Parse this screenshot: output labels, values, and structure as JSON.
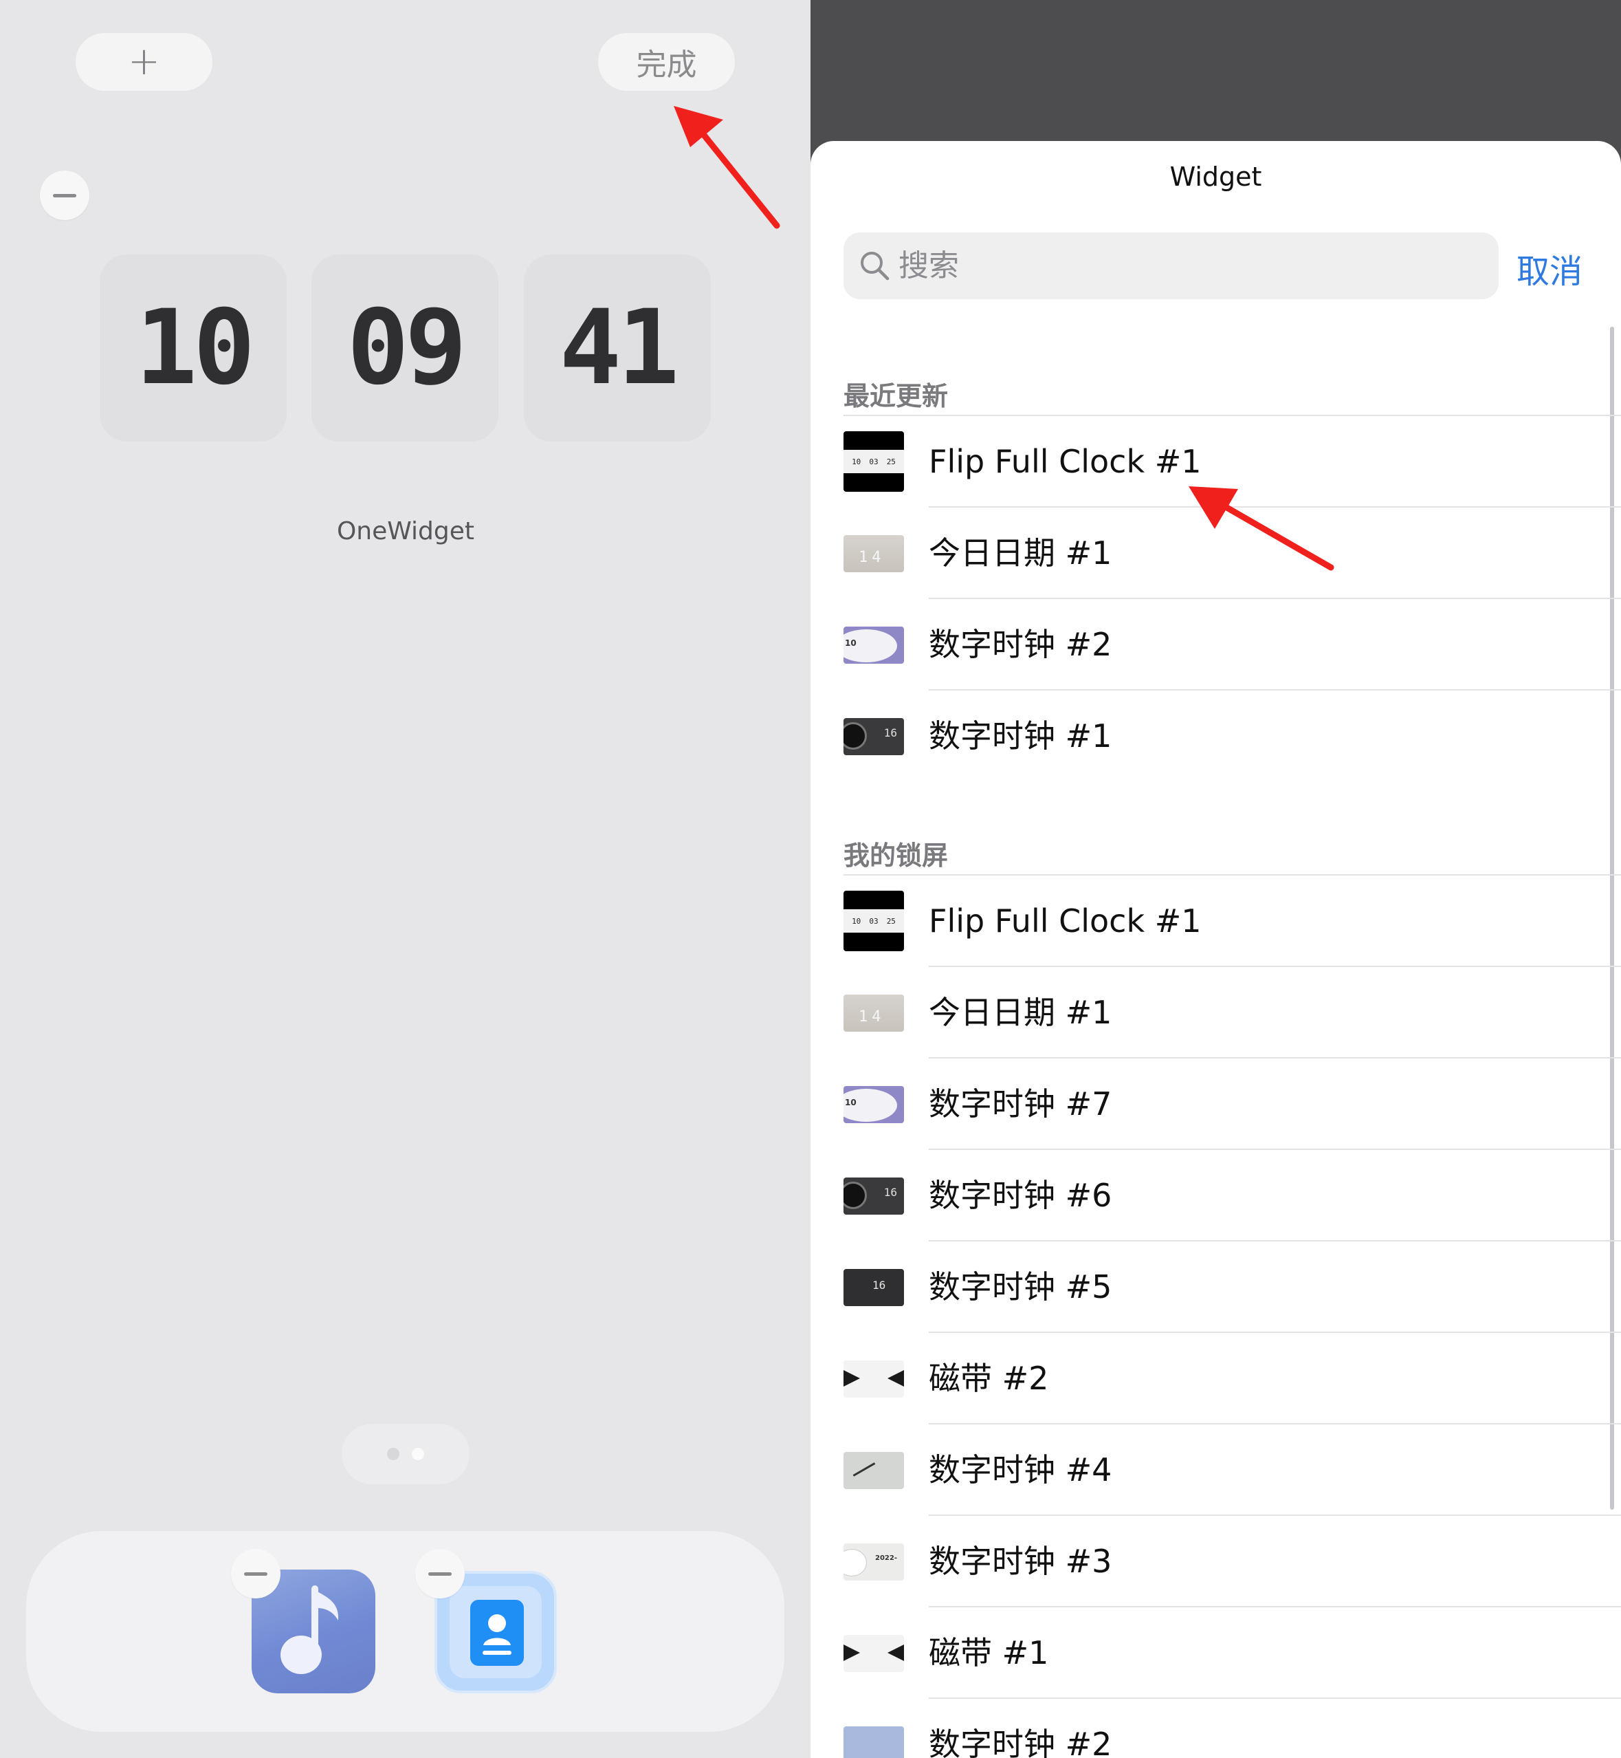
{
  "home": {
    "add_label": "+",
    "done_label": "完成",
    "clock": {
      "hours": "10",
      "minutes": "09",
      "seconds": "41"
    },
    "widget_caption": "OneWidget"
  },
  "sheet": {
    "title": "Widget",
    "search_placeholder": "搜索",
    "cancel_label": "取消",
    "sections": [
      {
        "header": "最近更新",
        "items": [
          {
            "label": "Flip Full Clock #1",
            "thumb": "flip-clock",
            "thumb_text": [
              "10",
              "03",
              "25"
            ]
          },
          {
            "label": "今日日期 #1",
            "thumb": "date",
            "thumb_text": "14"
          },
          {
            "label": "数字时钟 #2",
            "thumb": "purple-clock",
            "thumb_text": "10"
          },
          {
            "label": "数字时钟 #1",
            "thumb": "dark-gauge",
            "thumb_text": "16"
          }
        ]
      },
      {
        "header": "我的锁屏",
        "items": [
          {
            "label": "Flip Full Clock #1",
            "thumb": "flip-clock",
            "thumb_text": [
              "10",
              "03",
              "25"
            ]
          },
          {
            "label": "今日日期 #1",
            "thumb": "date",
            "thumb_text": "14"
          },
          {
            "label": "数字时钟 #7",
            "thumb": "purple-clock",
            "thumb_text": "10"
          },
          {
            "label": "数字时钟 #6",
            "thumb": "dark-gauge",
            "thumb_text": "16"
          },
          {
            "label": "数字时钟 #5",
            "thumb": "dark-digits",
            "thumb_text": "16"
          },
          {
            "label": "磁带 #2",
            "thumb": "tape"
          },
          {
            "label": "数字时钟 #4",
            "thumb": "grey-analog"
          },
          {
            "label": "数字时钟 #3",
            "thumb": "light-date",
            "thumb_text": "2022-"
          },
          {
            "label": "磁带 #1",
            "thumb": "tape"
          },
          {
            "label": "数字时钟 #2",
            "thumb": "blue"
          }
        ]
      }
    ]
  },
  "colors": {
    "accent": "#2f7ae0",
    "annotation_arrow": "#f0201c",
    "sheet_backdrop": "#4d4d4f"
  },
  "icons": {
    "search": "search-icon",
    "music_app": "music-note-icon",
    "contacts_app": "contact-card-icon"
  }
}
